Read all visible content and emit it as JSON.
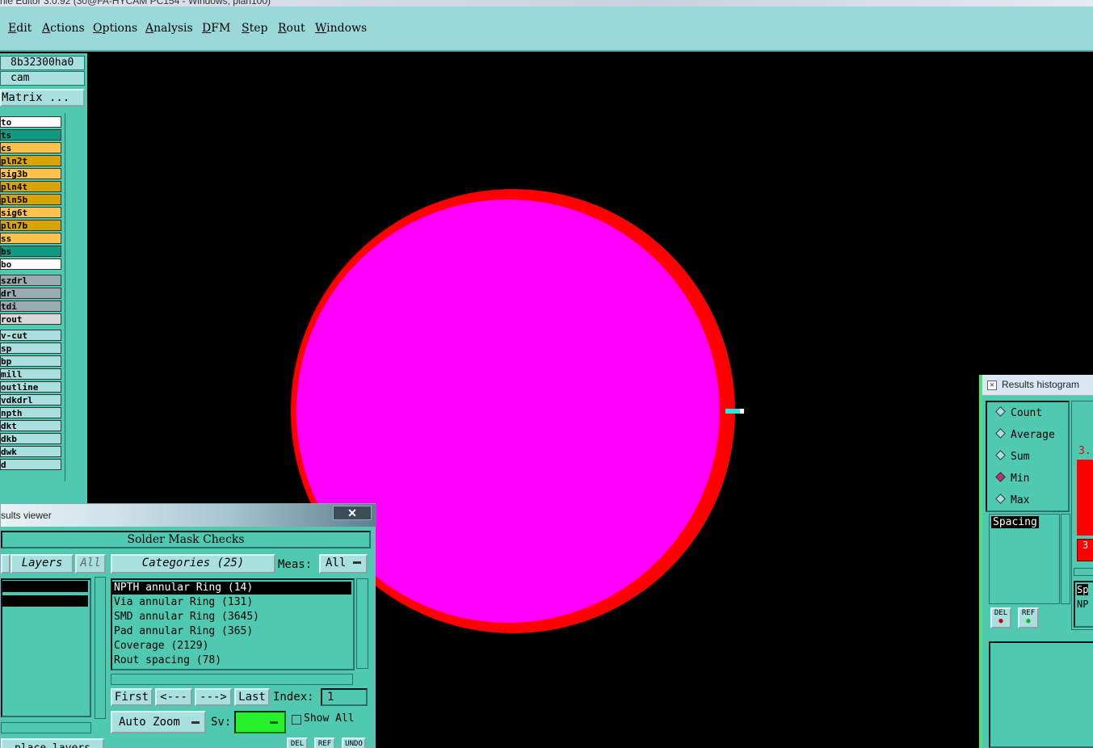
{
  "window": {
    "title": "nle Editor 3.0.92 (30@FA-HYCAM PC154 - Windows, plan100)"
  },
  "menu": [
    {
      "label": "Edit",
      "u": "E"
    },
    {
      "label": "Actions",
      "u": "A"
    },
    {
      "label": "Options",
      "u": "O"
    },
    {
      "label": "Analysis",
      "u": "A"
    },
    {
      "label": "DFM",
      "u": "D"
    },
    {
      "label": "Step",
      "u": "S"
    },
    {
      "label": "Rout",
      "u": "R"
    },
    {
      "label": "Windows",
      "u": "W"
    }
  ],
  "left": {
    "job": "8b32300ha0",
    "step": "cam",
    "matrix_button": "Matrix ...",
    "layers": [
      {
        "name": "to",
        "color": "#ffffff"
      },
      {
        "name": "ts",
        "color": "#109a80"
      },
      {
        "name": "cs",
        "color": "#ffc24d"
      },
      {
        "name": "pln2t",
        "color": "#d8a400"
      },
      {
        "name": "sig3b",
        "color": "#ffc24d"
      },
      {
        "name": "pln4t",
        "color": "#d8a400"
      },
      {
        "name": "pln5b",
        "color": "#d8a400"
      },
      {
        "name": "sig6t",
        "color": "#ffc24d"
      },
      {
        "name": "pln7b",
        "color": "#d8a400"
      },
      {
        "name": "ss",
        "color": "#ffc24d"
      },
      {
        "name": "bs",
        "color": "#109a80"
      },
      {
        "name": "bo",
        "color": "#ffffff"
      },
      {
        "name": "szdrl",
        "color": "#9aacb0"
      },
      {
        "name": "drl",
        "color": "#9aacb0"
      },
      {
        "name": "tdi",
        "color": "#9aacb0"
      },
      {
        "name": "rout",
        "color": "#d8d8d8"
      },
      {
        "name": "v-cut",
        "color": "#a8e0e0"
      },
      {
        "name": "sp",
        "color": "#a8e0e0"
      },
      {
        "name": "bp",
        "color": "#a8e0e0"
      },
      {
        "name": "mill",
        "color": "#a8e0e0"
      },
      {
        "name": "outline",
        "color": "#a8e0e0"
      },
      {
        "name": "vdkdrl",
        "color": "#a8e0e0"
      },
      {
        "name": "npth",
        "color": "#a8e0e0"
      },
      {
        "name": "dkt",
        "color": "#a8e0e0"
      },
      {
        "name": "dkb",
        "color": "#a8e0e0"
      },
      {
        "name": "dwk",
        "color": "#a8e0e0"
      },
      {
        "name": "d",
        "color": "#a8e0e0"
      }
    ]
  },
  "canvas": {
    "pad_fill": "#ff00ff",
    "pad_ring": "#ff0000"
  },
  "viewer": {
    "title": "sults viewer",
    "close": "✕",
    "header": "Solder Mask Checks",
    "layers_label": "Layers",
    "all_label": "All",
    "categories_label": "Categories (25)",
    "meas_label": "Meas:",
    "meas_value": "All",
    "categories": [
      "NPTH annular Ring (14)",
      "Via annular Ring (131)",
      "SMD annular Ring (3645)",
      "Pad annular Ring (365)",
      "Coverage (2129)",
      "Rout spacing (78)"
    ],
    "first": "First",
    "prev": "<---",
    "next": "--->",
    "last": "Last",
    "index_label": "Index:",
    "index_value": "1",
    "auto_zoom": "Auto Zoom",
    "sv_label": "Sv:",
    "show_all": "Show All",
    "place_layers": "place layers",
    "del": "DEL",
    "ref": "REF",
    "undo": "UNDO"
  },
  "histogram": {
    "title": "Results histogram",
    "options": [
      {
        "label": "Count",
        "selected": false
      },
      {
        "label": "Average",
        "selected": false
      },
      {
        "label": "Sum",
        "selected": false
      },
      {
        "label": "Min",
        "selected": true
      },
      {
        "label": "Max",
        "selected": false
      }
    ],
    "list_item": "Spacing",
    "del": "DEL",
    "ref": "REF",
    "bar_value_top": "3.",
    "bar_value_small": "3",
    "right_list": [
      "Sp",
      "NP"
    ]
  }
}
